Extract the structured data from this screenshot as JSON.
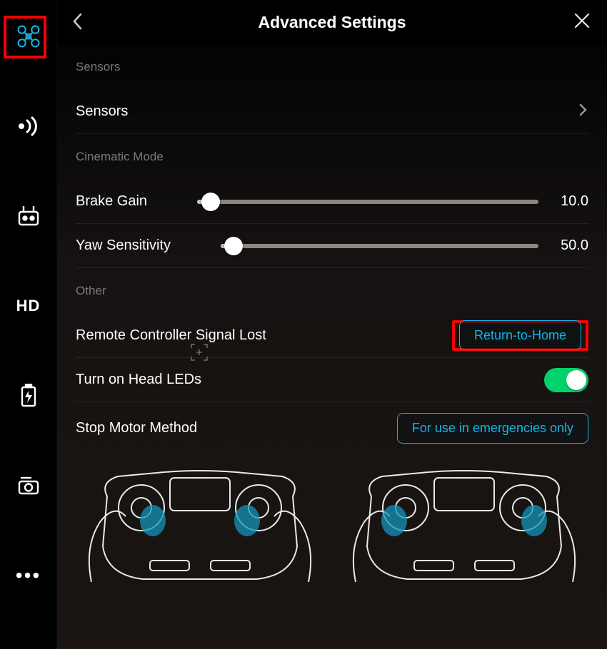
{
  "header": {
    "title": "Advanced Settings"
  },
  "sections": {
    "sensors": {
      "label": "Sensors",
      "row_label": "Sensors"
    },
    "cinematic": {
      "label": "Cinematic Mode",
      "brake_gain": {
        "label": "Brake Gain",
        "value": "10.0",
        "pct": 4
      },
      "yaw_sens": {
        "label": "Yaw Sensitivity",
        "value": "50.0",
        "pct": 4
      }
    },
    "other": {
      "label": "Other",
      "signal_lost": {
        "label": "Remote Controller Signal Lost",
        "action": "Return-to-Home"
      },
      "head_leds": {
        "label": "Turn on Head LEDs",
        "state": "on"
      },
      "stop_motor": {
        "label": "Stop Motor Method",
        "action": "For use in emergencies only"
      }
    }
  },
  "sidebar": {
    "items": [
      {
        "name": "drone-icon",
        "active": true
      },
      {
        "name": "signal-icon"
      },
      {
        "name": "rc-icon"
      },
      {
        "name": "hd-icon",
        "text": "HD"
      },
      {
        "name": "battery-icon"
      },
      {
        "name": "camera-icon"
      },
      {
        "name": "more-icon"
      }
    ]
  },
  "colors": {
    "accent": "#12b6e8",
    "toggle_on": "#00d36a",
    "highlight": "#ff0000"
  }
}
